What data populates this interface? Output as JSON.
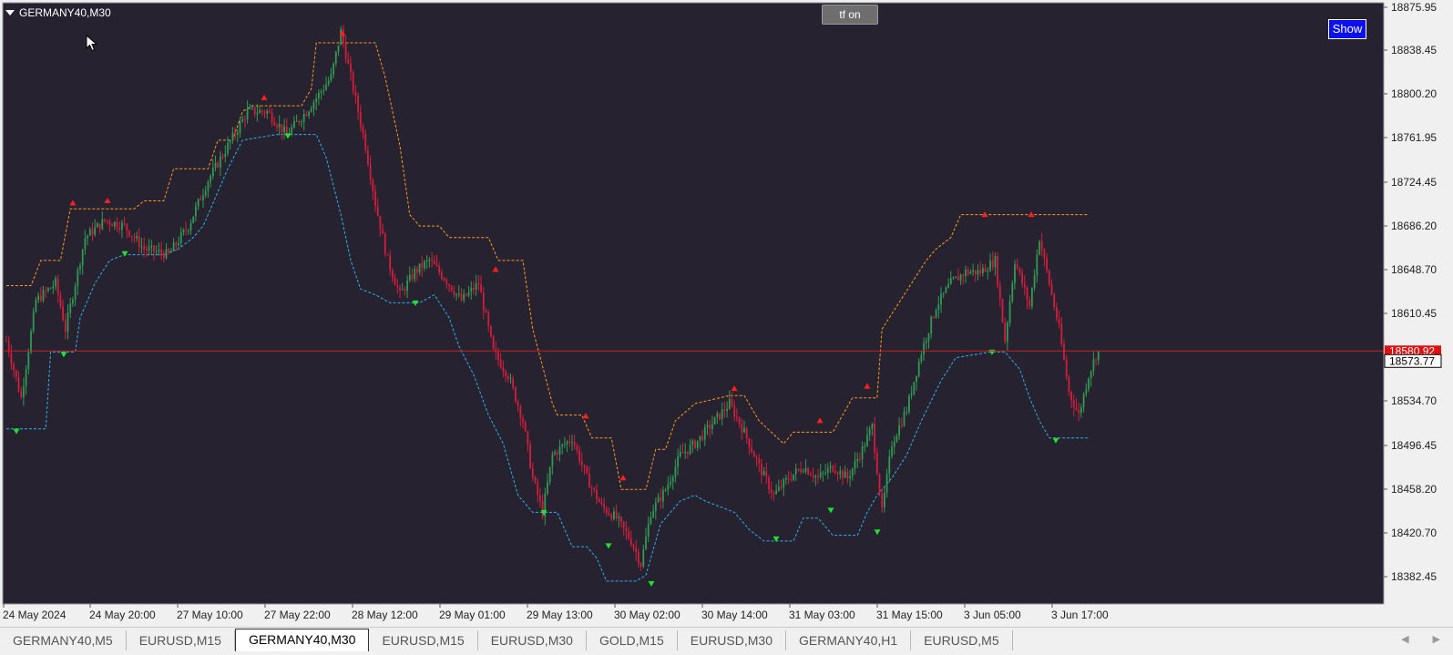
{
  "window": {
    "symbol_label": "GERMANY40,M30"
  },
  "buttons": {
    "tf_label": "tf on",
    "show_label": "Show"
  },
  "price_axis": {
    "labels": [
      "18875.95",
      "18838.45",
      "18800.20",
      "18761.95",
      "18724.45",
      "18686.20",
      "18648.70",
      "18610.45",
      "18534.70",
      "18496.45",
      "18458.20",
      "18420.70",
      "18382.45"
    ],
    "current_price_label": "18580.92",
    "bid_label": "18573.77"
  },
  "time_axis": {
    "labels": [
      "24 May 2024",
      "24 May 20:00",
      "27 May 10:00",
      "27 May 22:00",
      "28 May 12:00",
      "29 May 01:00",
      "29 May 13:00",
      "30 May 02:00",
      "30 May 14:00",
      "31 May 03:00",
      "31 May 15:00",
      "3 Jun 05:00",
      "3 Jun 17:00"
    ]
  },
  "tabs": [
    {
      "label": "GERMANY40,M5",
      "active": false
    },
    {
      "label": "EURUSD,M15",
      "active": false
    },
    {
      "label": "GERMANY40,M30",
      "active": true
    },
    {
      "label": "EURUSD,M15",
      "active": false
    },
    {
      "label": "EURUSD,M30",
      "active": false
    },
    {
      "label": "GOLD,M15",
      "active": false
    },
    {
      "label": "EURUSD,M30",
      "active": false
    },
    {
      "label": "GERMANY40,H1",
      "active": false
    },
    {
      "label": "EURUSD,M5",
      "active": false
    }
  ],
  "colors": {
    "chart_bg": "#27222f",
    "bull_candle": "#2e9a52",
    "bear_candle": "#d21e3c",
    "upper_channel": "#ff9a1f",
    "lower_channel": "#28b4f0",
    "price_line": "#c81e1e",
    "up_arrow": "#ff2020",
    "down_arrow": "#22e030"
  },
  "chart_data": {
    "type": "candlestick",
    "ylim": [
      18360,
      18885
    ],
    "price_line": 18580.92,
    "keypoints": [
      [
        0,
        18590
      ],
      [
        6,
        18540
      ],
      [
        12,
        18625
      ],
      [
        20,
        18640
      ],
      [
        24,
        18600
      ],
      [
        32,
        18680
      ],
      [
        40,
        18695
      ],
      [
        48,
        18690
      ],
      [
        56,
        18670
      ],
      [
        66,
        18665
      ],
      [
        74,
        18690
      ],
      [
        82,
        18730
      ],
      [
        90,
        18760
      ],
      [
        98,
        18790
      ],
      [
        106,
        18790
      ],
      [
        114,
        18770
      ],
      [
        122,
        18790
      ],
      [
        132,
        18820
      ],
      [
        136,
        18860
      ],
      [
        140,
        18820
      ],
      [
        146,
        18760
      ],
      [
        150,
        18710
      ],
      [
        155,
        18660
      ],
      [
        160,
        18630
      ],
      [
        166,
        18650
      ],
      [
        172,
        18660
      ],
      [
        178,
        18645
      ],
      [
        185,
        18625
      ],
      [
        192,
        18640
      ],
      [
        198,
        18580
      ],
      [
        204,
        18560
      ],
      [
        210,
        18520
      ],
      [
        214,
        18470
      ],
      [
        218,
        18440
      ],
      [
        222,
        18490
      ],
      [
        230,
        18505
      ],
      [
        236,
        18470
      ],
      [
        242,
        18445
      ],
      [
        248,
        18435
      ],
      [
        254,
        18415
      ],
      [
        258,
        18395
      ],
      [
        262,
        18440
      ],
      [
        268,
        18460
      ],
      [
        274,
        18490
      ],
      [
        280,
        18500
      ],
      [
        288,
        18520
      ],
      [
        294,
        18535
      ],
      [
        300,
        18510
      ],
      [
        306,
        18480
      ],
      [
        312,
        18455
      ],
      [
        318,
        18470
      ],
      [
        324,
        18480
      ],
      [
        330,
        18470
      ],
      [
        336,
        18480
      ],
      [
        342,
        18470
      ],
      [
        348,
        18495
      ],
      [
        352,
        18515
      ],
      [
        356,
        18440
      ],
      [
        360,
        18500
      ],
      [
        366,
        18530
      ],
      [
        372,
        18580
      ],
      [
        378,
        18620
      ],
      [
        384,
        18640
      ],
      [
        390,
        18650
      ],
      [
        396,
        18650
      ],
      [
        402,
        18660
      ],
      [
        406,
        18590
      ],
      [
        410,
        18660
      ],
      [
        416,
        18620
      ],
      [
        420,
        18680
      ],
      [
        424,
        18640
      ],
      [
        428,
        18600
      ],
      [
        432,
        18545
      ],
      [
        436,
        18525
      ],
      [
        440,
        18560
      ],
      [
        444,
        18583
      ]
    ],
    "upper_channel": [
      [
        0,
        18638
      ],
      [
        10,
        18638
      ],
      [
        14,
        18660
      ],
      [
        22,
        18660
      ],
      [
        26,
        18705
      ],
      [
        52,
        18705
      ],
      [
        56,
        18712
      ],
      [
        64,
        18712
      ],
      [
        68,
        18740
      ],
      [
        82,
        18740
      ],
      [
        86,
        18765
      ],
      [
        92,
        18765
      ],
      [
        96,
        18790
      ],
      [
        100,
        18795
      ],
      [
        120,
        18795
      ],
      [
        124,
        18810
      ],
      [
        126,
        18850
      ],
      [
        150,
        18850
      ],
      [
        154,
        18820
      ],
      [
        160,
        18760
      ],
      [
        164,
        18700
      ],
      [
        168,
        18690
      ],
      [
        176,
        18690
      ],
      [
        180,
        18680
      ],
      [
        196,
        18680
      ],
      [
        200,
        18660
      ],
      [
        210,
        18660
      ],
      [
        214,
        18600
      ],
      [
        222,
        18535
      ],
      [
        224,
        18525
      ],
      [
        234,
        18525
      ],
      [
        238,
        18505
      ],
      [
        246,
        18505
      ],
      [
        250,
        18460
      ],
      [
        260,
        18460
      ],
      [
        264,
        18495
      ],
      [
        268,
        18495
      ],
      [
        272,
        18520
      ],
      [
        280,
        18535
      ],
      [
        294,
        18542
      ],
      [
        300,
        18542
      ],
      [
        306,
        18520
      ],
      [
        316,
        18500
      ],
      [
        318,
        18505
      ],
      [
        320,
        18510
      ],
      [
        336,
        18510
      ],
      [
        340,
        18525
      ],
      [
        344,
        18540
      ],
      [
        354,
        18540
      ],
      [
        356,
        18600
      ],
      [
        362,
        18620
      ],
      [
        368,
        18640
      ],
      [
        374,
        18660
      ],
      [
        378,
        18670
      ],
      [
        384,
        18680
      ],
      [
        388,
        18700
      ],
      [
        440,
        18700
      ]
    ],
    "lower_channel": [
      [
        0,
        18513
      ],
      [
        16,
        18513
      ],
      [
        18,
        18580
      ],
      [
        28,
        18580
      ],
      [
        30,
        18610
      ],
      [
        36,
        18640
      ],
      [
        42,
        18660
      ],
      [
        48,
        18665
      ],
      [
        64,
        18665
      ],
      [
        70,
        18670
      ],
      [
        76,
        18680
      ],
      [
        80,
        18690
      ],
      [
        84,
        18710
      ],
      [
        90,
        18740
      ],
      [
        96,
        18765
      ],
      [
        110,
        18770
      ],
      [
        126,
        18770
      ],
      [
        130,
        18750
      ],
      [
        136,
        18700
      ],
      [
        140,
        18660
      ],
      [
        144,
        18635
      ],
      [
        150,
        18630
      ],
      [
        156,
        18623
      ],
      [
        168,
        18623
      ],
      [
        174,
        18630
      ],
      [
        180,
        18610
      ],
      [
        184,
        18585
      ],
      [
        190,
        18560
      ],
      [
        196,
        18525
      ],
      [
        202,
        18500
      ],
      [
        208,
        18455
      ],
      [
        214,
        18440
      ],
      [
        224,
        18440
      ],
      [
        230,
        18410
      ],
      [
        236,
        18410
      ],
      [
        240,
        18400
      ],
      [
        244,
        18380
      ],
      [
        256,
        18380
      ],
      [
        260,
        18385
      ],
      [
        266,
        18430
      ],
      [
        274,
        18450
      ],
      [
        280,
        18455
      ],
      [
        284,
        18450
      ],
      [
        290,
        18445
      ],
      [
        296,
        18440
      ],
      [
        302,
        18425
      ],
      [
        308,
        18415
      ],
      [
        320,
        18415
      ],
      [
        324,
        18435
      ],
      [
        330,
        18435
      ],
      [
        336,
        18420
      ],
      [
        346,
        18420
      ],
      [
        350,
        18440
      ],
      [
        354,
        18455
      ],
      [
        360,
        18470
      ],
      [
        366,
        18490
      ],
      [
        372,
        18520
      ],
      [
        380,
        18555
      ],
      [
        386,
        18575
      ],
      [
        400,
        18580
      ],
      [
        406,
        18580
      ],
      [
        412,
        18565
      ],
      [
        416,
        18540
      ],
      [
        420,
        18520
      ],
      [
        424,
        18505
      ],
      [
        440,
        18505
      ]
    ],
    "up_arrows": [
      [
        80,
        18708
      ],
      [
        118,
        18710
      ],
      [
        290,
        18800
      ],
      [
        376,
        18856
      ],
      [
        544,
        18650
      ],
      [
        643,
        18522
      ],
      [
        684,
        18468
      ],
      [
        806,
        18546
      ],
      [
        900,
        18518
      ],
      [
        952,
        18548
      ],
      [
        1081,
        18698
      ],
      [
        1132,
        18698
      ]
    ],
    "down_arrows": [
      [
        18,
        18513
      ],
      [
        70,
        18580
      ],
      [
        137,
        18668
      ],
      [
        316,
        18771
      ],
      [
        456,
        18625
      ],
      [
        597,
        18442
      ],
      [
        668,
        18413
      ],
      [
        715,
        18380
      ],
      [
        852,
        18419
      ],
      [
        912,
        18444
      ],
      [
        963,
        18425
      ],
      [
        1089,
        18582
      ],
      [
        1159,
        18505
      ]
    ]
  }
}
